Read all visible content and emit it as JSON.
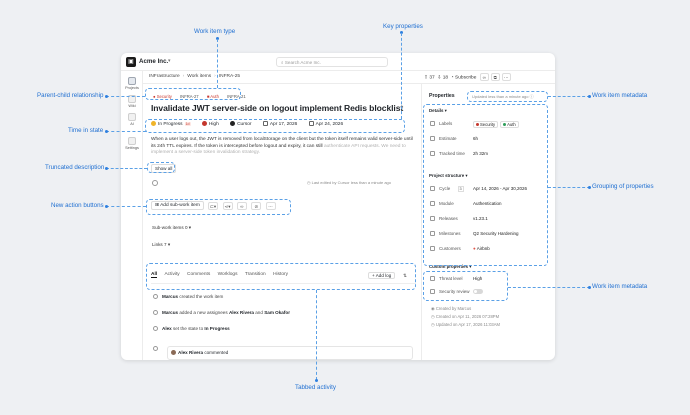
{
  "annotations": {
    "work_item_type": "Work item type",
    "key_properties": "Key properties",
    "parent_child": "Parent-child relationship",
    "work_item_metadata_top": "Work item metadata",
    "time_in_state": "Time in state",
    "truncated_description": "Truncated description",
    "grouping_of_properties": "Grouping of properties",
    "new_action_buttons": "New action buttons",
    "work_item_metadata_bottom": "Work item metadata",
    "tabbed_activity": "Tabbed activity"
  },
  "app": {
    "workspace": "Acme Inc.",
    "search_placeholder": "Search Acme Inc."
  },
  "rail": [
    {
      "label": "Projects",
      "active": true
    },
    {
      "label": "Wiki"
    },
    {
      "label": "AI"
    },
    {
      "label": "Settings"
    }
  ],
  "breadcrumbs": [
    "INFrastructure",
    "Work items",
    "INFRA-25"
  ],
  "header": {
    "up_count": "37",
    "down_count": "18",
    "subscribe": "Subscribe"
  },
  "item": {
    "type_label": "Security",
    "parent_key": "INFRA-27",
    "type2_label": "Auth",
    "key": "INFRA-21",
    "title": "Invalidate JWT server-side on logout implement Redis blocklist",
    "state": "In Progress",
    "state_time": "1d",
    "priority": "High",
    "assignee": "Cursor",
    "start_date": "Apr 17, 2026",
    "due_date": "Apr 24, 2026",
    "description": "When a user logs out, the JWT is removed from localStorage on the client but the token itself remains valid server-side until its 24h TTL expires. If the token is intercepted before logout and expiry, it can still",
    "description_fade": "authenticate API requests. We need to implement a server-side token invalidation strategy.",
    "show_all": "Show all",
    "last_edited": "Last edited by Cursor less than a minute ago"
  },
  "actions": {
    "add_sub": "Add sub-work item"
  },
  "sections": {
    "sub_items": "Sub-work items",
    "sub_count": "0",
    "links": "Links",
    "links_count": "7"
  },
  "tabs": [
    "All",
    "Activity",
    "Comments",
    "Worklogs",
    "Transition",
    "History"
  ],
  "add_log": "+ Add log",
  "activity": [
    {
      "actor": "Marcus",
      "text": "created the work item"
    },
    {
      "actor": "Marcus",
      "text": "added a new assignees",
      "extra1": "Alex Rivera",
      "and": "and",
      "extra2": "Sam Okafor"
    },
    {
      "actor": "Alex",
      "text": "set the state to",
      "extra1": "In Progress"
    }
  ],
  "comment": {
    "author": "Alex Rivera",
    "text": "commented"
  },
  "properties": {
    "header": "Properties",
    "updated": "Updated less than a minute ago",
    "details_header": "Details",
    "labels_label": "Labels",
    "labels": [
      {
        "name": "Security",
        "color": "#c4372d"
      },
      {
        "name": "Auth",
        "color": "#2f9e5a"
      }
    ],
    "estimate_label": "Estimate",
    "estimate": "6h",
    "tracked_label": "Tracked time",
    "tracked": "2h 32m",
    "structure_header": "Project structure",
    "cycle_label": "Cycle",
    "cycle_num": "3",
    "cycle": "Apr 14, 2026 - Apr 30,2026",
    "module_label": "Module",
    "module": "Authentication",
    "releases_label": "Releases",
    "releases": "v1.23.1",
    "milestones_label": "Milestones",
    "milestones": "Q2 Security Hardening",
    "customers_label": "Customers",
    "customers": "Airbnb",
    "custom_header": "Custom properties",
    "threat_label": "Threat level",
    "threat": "High",
    "review_label": "Security review",
    "created_by": "Created by Marcus",
    "created_on": "Created on Apr 11, 2026 07:28PM",
    "updated_on": "Updated on Apr 17, 2026 11:03AM"
  }
}
